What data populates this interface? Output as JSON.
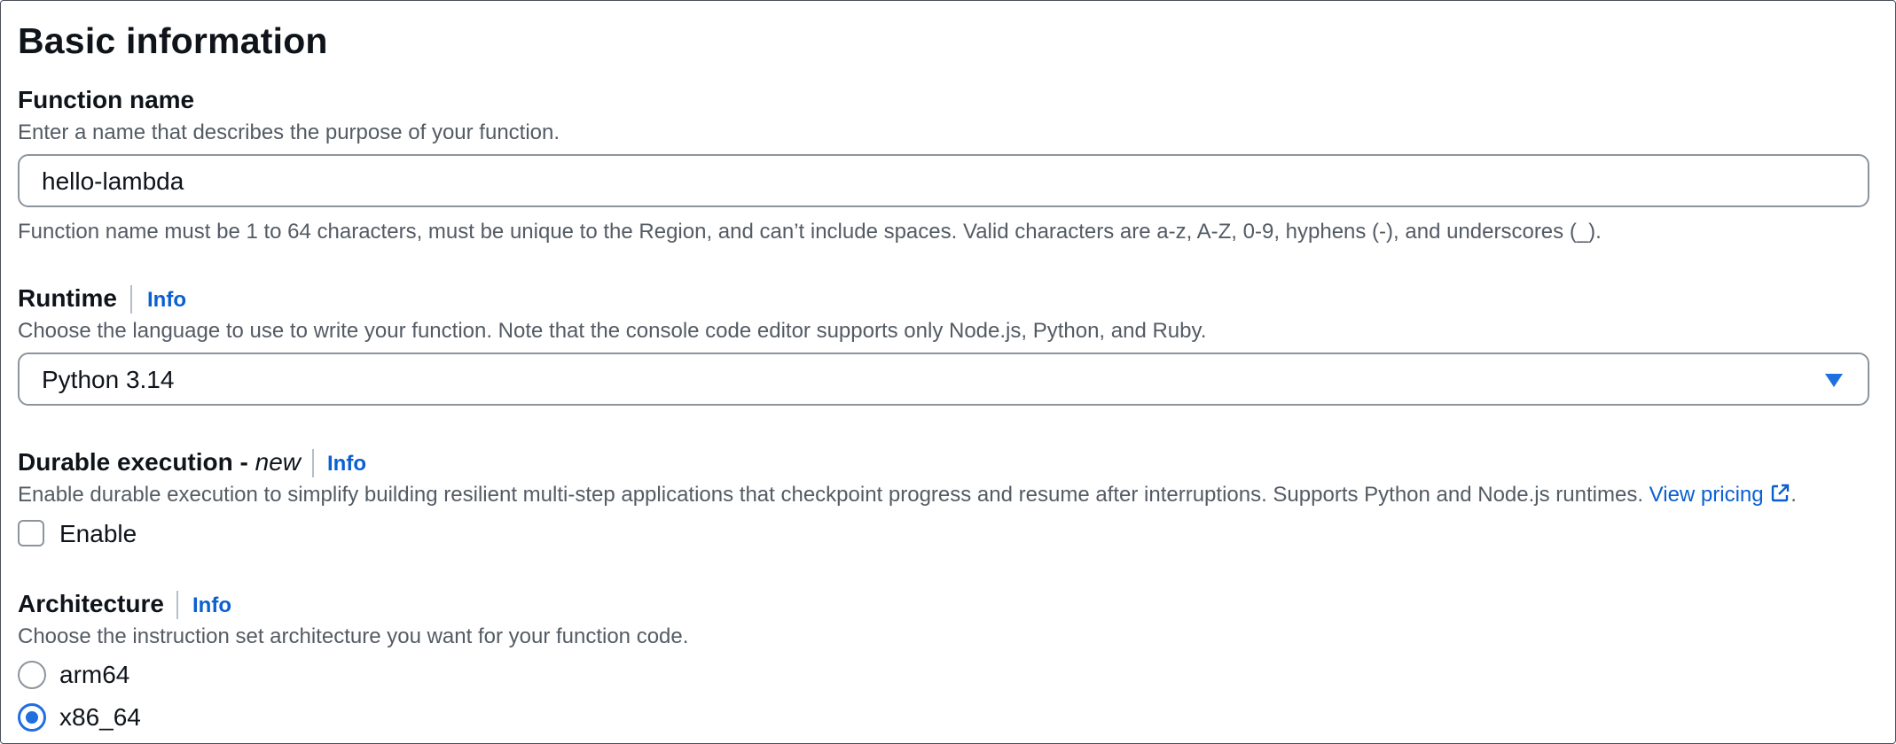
{
  "section": {
    "title": "Basic information"
  },
  "function_name": {
    "label": "Function name",
    "description": "Enter a name that describes the purpose of your function.",
    "value": "hello-lambda",
    "constraint": "Function name must be 1 to 64 characters, must be unique to the Region, and can’t include spaces. Valid characters are a-z, A-Z, 0-9, hyphens (-), and underscores (_)."
  },
  "runtime": {
    "label": "Runtime",
    "info": "Info",
    "description": "Choose the language to use to write your function. Note that the console code editor supports only Node.js, Python, and Ruby.",
    "selected": "Python 3.14"
  },
  "durable": {
    "label": "Durable execution - ",
    "label_new": "new",
    "info": "Info",
    "description": "Enable durable execution to simplify building resilient multi-step applications that checkpoint progress and resume after interruptions. Supports Python and Node.js runtimes.",
    "link": "View pricing",
    "trailing": ".",
    "checkbox_label": "Enable",
    "checked": false
  },
  "architecture": {
    "label": "Architecture",
    "info": "Info",
    "description": "Choose the instruction set architecture you want for your function code.",
    "options": [
      "arm64",
      "x86_64"
    ],
    "selected": "x86_64"
  },
  "colors": {
    "accent": "#0a5fd1",
    "border": "#8c949e",
    "text": "#0f141a",
    "muted": "#545b64"
  },
  "icons": {
    "dropdown": "caret-down-icon",
    "external": "external-link-icon"
  }
}
